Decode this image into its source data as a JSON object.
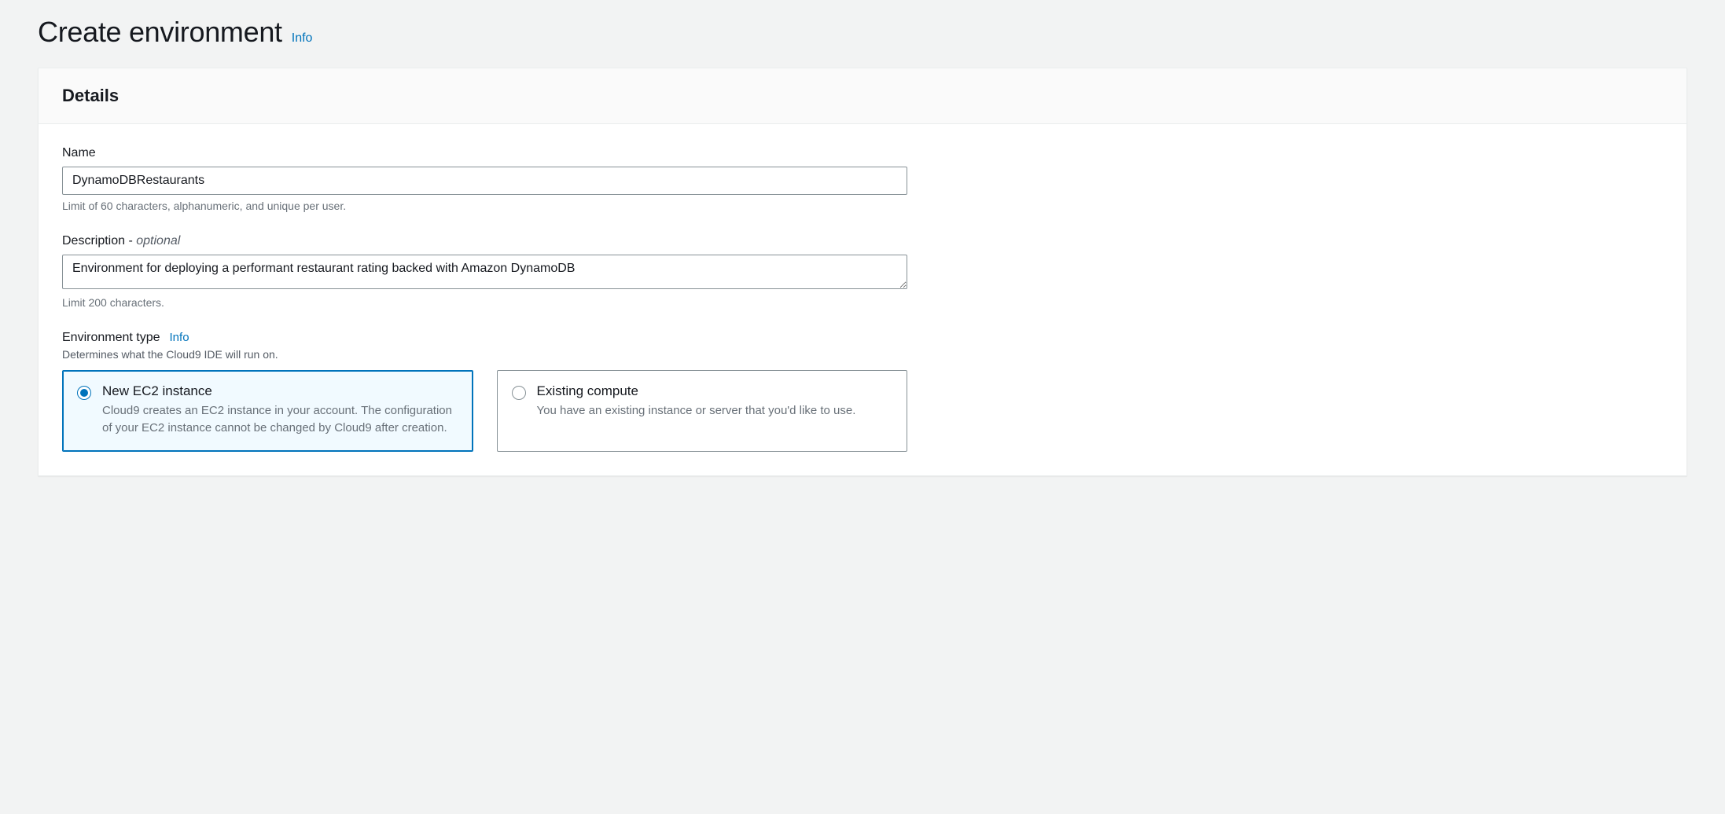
{
  "header": {
    "title": "Create environment",
    "info_label": "Info"
  },
  "panel": {
    "title": "Details"
  },
  "form": {
    "name": {
      "label": "Name",
      "value": "DynamoDBRestaurants",
      "help": "Limit of 60 characters, alphanumeric, and unique per user."
    },
    "description": {
      "label_main": "Description - ",
      "label_optional": "optional",
      "value": "Environment for deploying a performant restaurant rating backed with Amazon DynamoDB",
      "help": "Limit 200 characters."
    },
    "env_type": {
      "label": "Environment type",
      "info_label": "Info",
      "sublabel": "Determines what the Cloud9 IDE will run on.",
      "options": [
        {
          "title": "New EC2 instance",
          "desc": "Cloud9 creates an EC2 instance in your account. The configuration of your EC2 instance cannot be changed by Cloud9 after creation.",
          "selected": true
        },
        {
          "title": "Existing compute",
          "desc": "You have an existing instance or server that you'd like to use.",
          "selected": false
        }
      ]
    }
  }
}
